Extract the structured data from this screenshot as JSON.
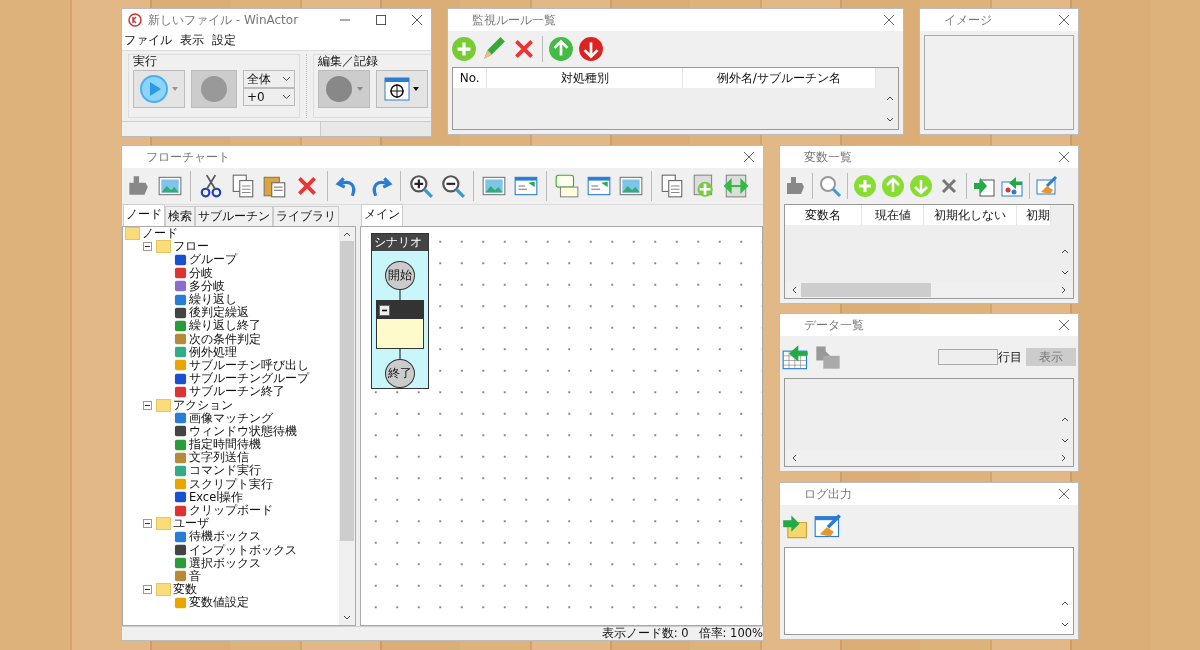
{
  "main_window": {
    "title": "新しいファイル - WinActor",
    "menu": [
      "ファイル",
      "表示",
      "設定"
    ],
    "run_group": {
      "label": "実行",
      "range_select": "全体",
      "offset_select": "+0"
    },
    "edit_group": {
      "label": "編集／記録"
    }
  },
  "monitor_rules": {
    "title": "監視ルール一覧",
    "columns": [
      "No.",
      "対処種別",
      "例外名/サブルーチン名"
    ]
  },
  "image_panel": {
    "title": "イメージ"
  },
  "flowchart": {
    "title": "フローチャート",
    "left_tabs": [
      {
        "label": "ノード",
        "selected": true
      },
      {
        "label": "検索",
        "selected": false
      },
      {
        "label": "サブルーチン",
        "selected": false
      },
      {
        "label": "ライブラリ",
        "selected": false
      }
    ],
    "tree": [
      {
        "label": "ノード",
        "children": [
          {
            "label": "フロー",
            "expanded": true,
            "children": [
              {
                "label": "グループ"
              },
              {
                "label": "分岐"
              },
              {
                "label": "多分岐"
              },
              {
                "label": "繰り返し"
              },
              {
                "label": "後判定繰返"
              },
              {
                "label": "繰り返し終了"
              },
              {
                "label": "次の条件判定"
              },
              {
                "label": "例外処理"
              },
              {
                "label": "サブルーチン呼び出し"
              },
              {
                "label": "サブルーチングループ"
              },
              {
                "label": "サブルーチン終了"
              }
            ]
          },
          {
            "label": "アクション",
            "expanded": true,
            "children": [
              {
                "label": "画像マッチング"
              },
              {
                "label": "ウィンドウ状態待機"
              },
              {
                "label": "指定時間待機"
              },
              {
                "label": "文字列送信"
              },
              {
                "label": "コマンド実行"
              },
              {
                "label": "スクリプト実行"
              },
              {
                "label": "Excel操作"
              },
              {
                "label": "クリップボード"
              }
            ]
          },
          {
            "label": "ユーザ",
            "expanded": true,
            "children": [
              {
                "label": "待機ボックス"
              },
              {
                "label": "インプットボックス"
              },
              {
                "label": "選択ボックス"
              },
              {
                "label": "音"
              }
            ]
          },
          {
            "label": "変数",
            "expanded": true,
            "children": [
              {
                "label": "変数値設定"
              }
            ]
          }
        ]
      }
    ],
    "canvas_tabs": [
      {
        "label": "メイン",
        "selected": true
      }
    ],
    "scenario": {
      "title": "シナリオ",
      "start": "開始",
      "end": "終了"
    },
    "status": [
      "表示ノード数: 0",
      "倍率: 100%"
    ]
  },
  "variables": {
    "title": "変数一覧",
    "columns": [
      "変数名",
      "現在値",
      "初期化しない",
      "初期"
    ]
  },
  "data_list": {
    "title": "データ一覧",
    "row_label": "行目",
    "show_button": {
      "label": "表示",
      "disabled": true
    }
  },
  "log": {
    "title": "ログ出力"
  }
}
